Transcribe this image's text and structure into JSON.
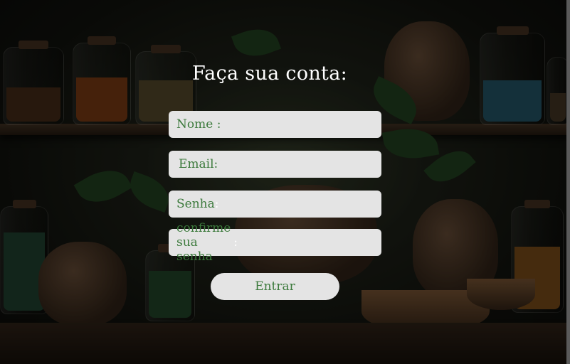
{
  "form": {
    "title": "Faça sua conta:",
    "fields": [
      {
        "label": "Nome :",
        "suffix": "",
        "value": ""
      },
      {
        "label": "Email:",
        "suffix": "",
        "value": ""
      },
      {
        "label": "Senha",
        "suffix": ":",
        "value": ""
      },
      {
        "label": "confirme sua senha",
        "suffix": ":",
        "value": ""
      }
    ],
    "submit_label": "Entrar"
  },
  "colors": {
    "label_text": "#3c7a3c",
    "field_background": "#e4e4e4",
    "title_text": "#ffffff"
  }
}
